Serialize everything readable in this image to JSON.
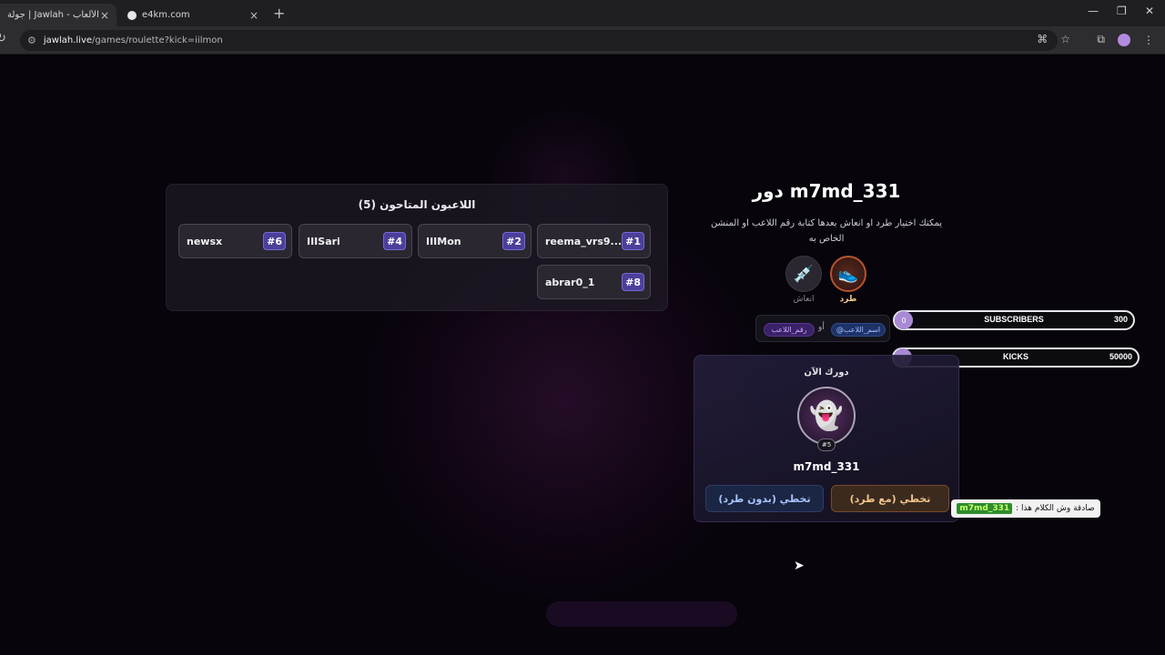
{
  "browser": {
    "tabs": [
      {
        "title": "جولة | Jawlah - منصة الألعاب",
        "active": true
      },
      {
        "title": "e4km.com",
        "active": false
      }
    ],
    "url_host": "jawlah.live",
    "url_path": "/games/roulette?kick=iilmon",
    "icons": {
      "reload": "reload-icon",
      "tune": "site-info-icon",
      "translate": "translate-icon",
      "star": "bookmark-star-icon",
      "extensions": "extensions-icon",
      "menu": "kebab-menu-icon"
    }
  },
  "players_panel": {
    "title": "اللاعبون المتاحون (5)",
    "players": [
      {
        "name": "reema_vrs9...",
        "number": "#1"
      },
      {
        "name": "IIIMon",
        "number": "#2"
      },
      {
        "name": "IIISari",
        "number": "#4"
      },
      {
        "name": "newsx",
        "number": "#6"
      },
      {
        "name": "abrar0_1",
        "number": "#8"
      }
    ]
  },
  "turn": {
    "title": "دور m7md_331",
    "description": "يمكنك اختيار طرد او انعاش بعدها كتابة رقم اللاعب او المنشن الخاص به",
    "actions": {
      "kick": {
        "label": "طرد",
        "icon": "shoe-kick-icon",
        "selected": true
      },
      "revive": {
        "label": "انعاش",
        "icon": "syringe-icon",
        "selected": false
      }
    },
    "hint": {
      "name_chip": "@اسم_اللاعب",
      "or": "أو",
      "num_chip": "رقم_اللاعب"
    }
  },
  "progress": {
    "subscribers": {
      "label": "SUBSCRIBERS",
      "current": "0",
      "max": "300",
      "fraction": 0
    },
    "kicks": {
      "label": "KICKS",
      "current": "0",
      "max": "50000",
      "fraction": 0
    }
  },
  "current_turn": {
    "label": "دورك الآن",
    "avatar_icon": "ghost-avatar-icon",
    "badge": "#5",
    "name": "m7md_331",
    "buttons": {
      "with_kick": "تخطي (مع طرد)",
      "no_kick": "تخطي (بدون طرد)"
    }
  },
  "toast": {
    "user": "m7md_331",
    "text": "صادقة وش الكلام هذا :"
  },
  "colors": {
    "accent_purple": "#4b3f9a",
    "kick_orange": "#b5542f",
    "progress": "#a989d4"
  }
}
